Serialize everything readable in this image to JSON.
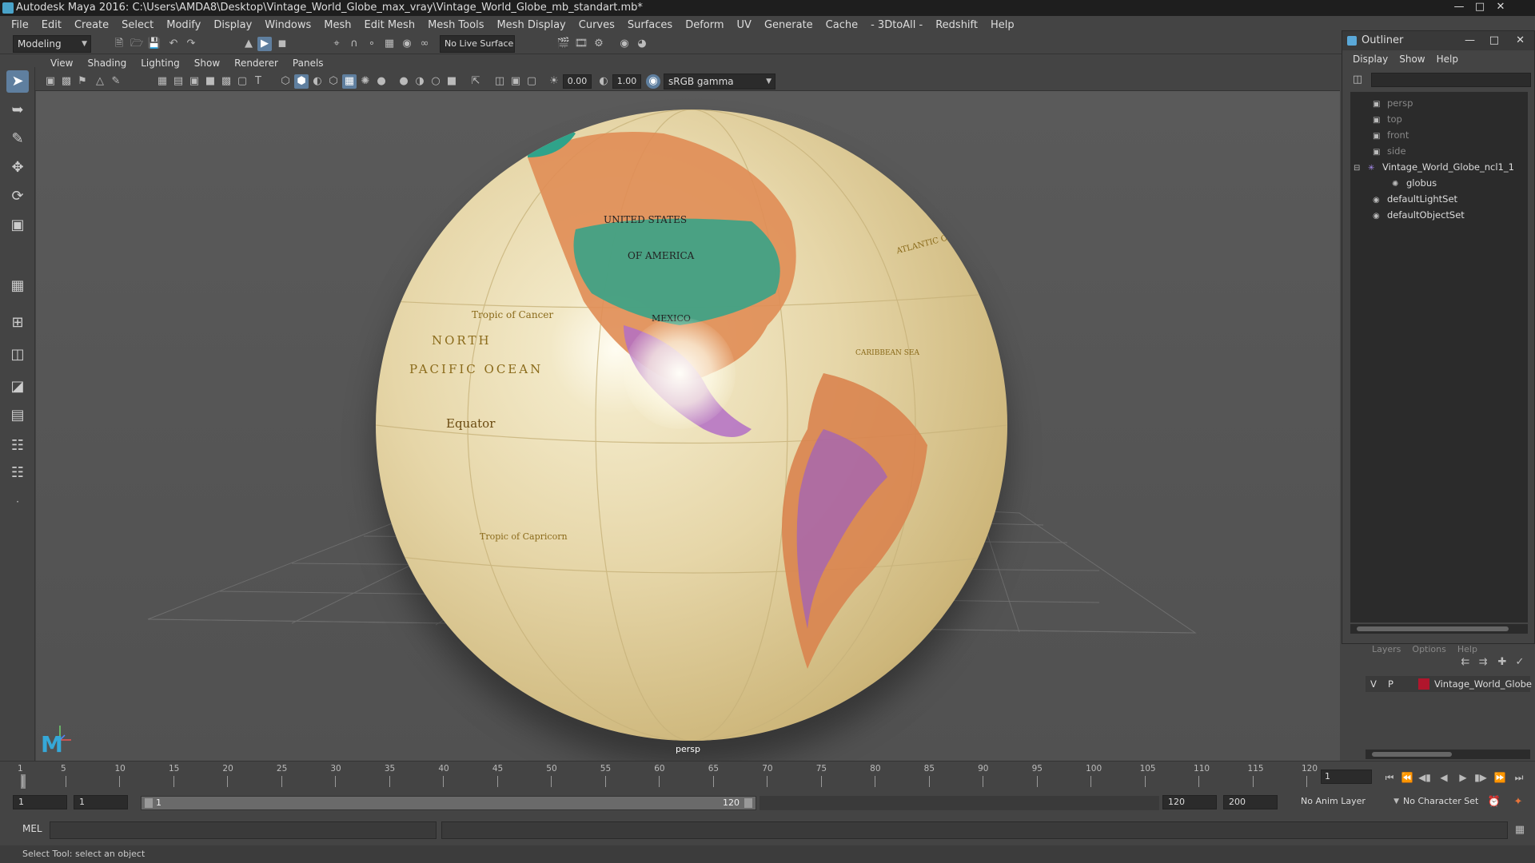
{
  "window": {
    "title": "Autodesk Maya 2016: C:\\Users\\AMDA8\\Desktop\\Vintage_World_Globe_max_vray\\Vintage_World_Globe_mb_standart.mb*"
  },
  "menubar": [
    "File",
    "Edit",
    "Create",
    "Select",
    "Modify",
    "Display",
    "Windows",
    "Mesh",
    "Edit Mesh",
    "Mesh Tools",
    "Mesh Display",
    "Curves",
    "Surfaces",
    "Deform",
    "UV",
    "Generate",
    "Cache",
    "- 3DtoAll -",
    "Redshift",
    "Help"
  ],
  "shelf": {
    "mode": "Modeling",
    "live_surface": "No Live Surface"
  },
  "panel_menu": [
    "View",
    "Shading",
    "Lighting",
    "Show",
    "Renderer",
    "Panels"
  ],
  "panel_tools": {
    "exposure": "0.00",
    "gamma": "1.00",
    "color_space": "sRGB gamma"
  },
  "viewport": {
    "camera_label": "persp",
    "globe_labels": {
      "us1": "UNITED STATES",
      "us2": "OF AMERICA",
      "mexico": "MEXICO",
      "tropic_cancer": "Tropic of Cancer",
      "north": "NORTH",
      "pacific": "PACIFIC OCEAN",
      "equator": "Equator",
      "tropic_capricorn": "Tropic of Capricorn",
      "atlantic": "ATLANTIC OCEAN",
      "caribbean": "CARIBBEAN SEA"
    }
  },
  "outliner": {
    "title": "Outliner",
    "menu": [
      "Display",
      "Show",
      "Help"
    ],
    "items": [
      {
        "label": "persp",
        "dim": true
      },
      {
        "label": "top",
        "dim": true
      },
      {
        "label": "front",
        "dim": true
      },
      {
        "label": "side",
        "dim": true
      },
      {
        "label": "Vintage_World_Globe_ncl1_1",
        "dim": false
      },
      {
        "label": "globus",
        "dim": false
      },
      {
        "label": "defaultLightSet",
        "dim": false
      },
      {
        "label": "defaultObjectSet",
        "dim": false
      }
    ]
  },
  "layers": {
    "menu": [
      "Layers",
      "Options",
      "Help"
    ],
    "row": {
      "v": "V",
      "p": "P",
      "name": "Vintage_World_Globe",
      "color": "#b0162c"
    }
  },
  "timeline": {
    "ticks": [
      "1",
      "5",
      "10",
      "15",
      "20",
      "25",
      "30",
      "35",
      "40",
      "45",
      "50",
      "55",
      "60",
      "65",
      "70",
      "75",
      "80",
      "85",
      "90",
      "95",
      "100",
      "105",
      "110",
      "115",
      "120"
    ],
    "current_frame": "1"
  },
  "range": {
    "start": "1",
    "playback_start": "1",
    "bar_start": "1",
    "bar_end": "120",
    "playback_end": "120",
    "end": "200",
    "anim_layer": "No Anim Layer",
    "character_set": "No Character Set"
  },
  "mel": {
    "label": "MEL"
  },
  "status": {
    "text": "Select Tool: select an object"
  },
  "colors": {
    "accent": "#5f7f9f",
    "maya_blue": "#35a8d8"
  }
}
